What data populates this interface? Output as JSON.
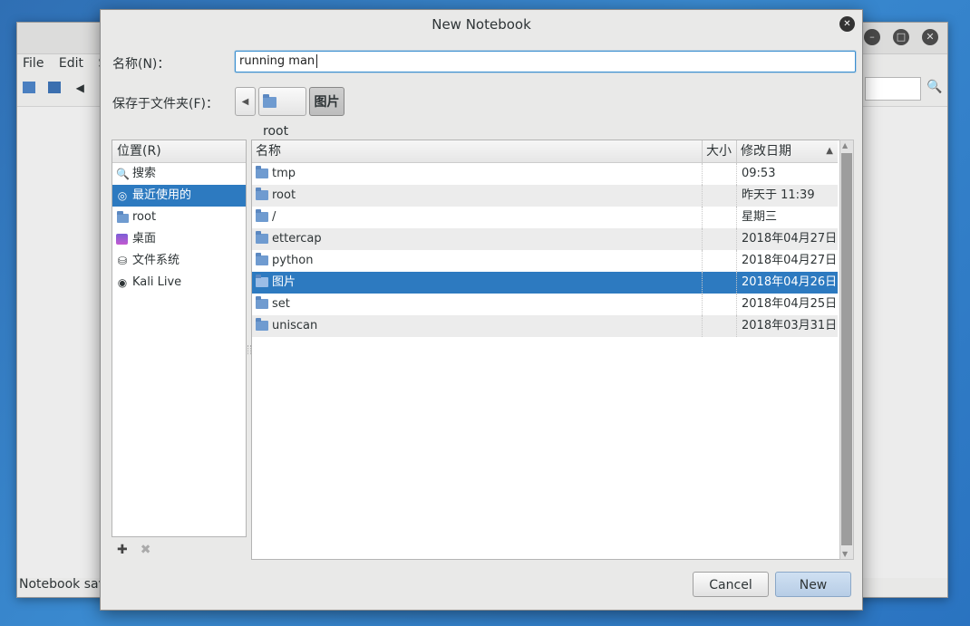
{
  "background_window": {
    "menu": [
      "File",
      "Edit",
      "Se"
    ],
    "status": "Notebook save"
  },
  "dialog": {
    "title": "New Notebook",
    "name_label": "名称(N)：",
    "name_value": "running man",
    "folder_label": "保存于文件夹(F)：",
    "path": [
      "root",
      "图片"
    ]
  },
  "places": {
    "header": "位置(R)",
    "items": [
      {
        "label": "搜索",
        "icon": "search-icon"
      },
      {
        "label": "最近使用的",
        "icon": "recent-icon",
        "selected": true
      },
      {
        "label": "root",
        "icon": "home-folder-icon"
      },
      {
        "label": "桌面",
        "icon": "desktop-icon"
      },
      {
        "label": "文件系统",
        "icon": "filesystem-icon"
      },
      {
        "label": "Kali Live",
        "icon": "disc-icon"
      }
    ]
  },
  "files": {
    "columns": {
      "name": "名称",
      "size": "大小",
      "modified": "修改日期"
    },
    "rows": [
      {
        "name": "tmp",
        "size": "",
        "modified": "09:53"
      },
      {
        "name": "root",
        "size": "",
        "modified": "昨天于 11:39"
      },
      {
        "name": "/",
        "size": "",
        "modified": "星期三"
      },
      {
        "name": "ettercap",
        "size": "",
        "modified": "2018年04月27日"
      },
      {
        "name": "python",
        "size": "",
        "modified": "2018年04月27日"
      },
      {
        "name": "图片",
        "size": "",
        "modified": "2018年04月26日",
        "selected": true
      },
      {
        "name": "set",
        "size": "",
        "modified": "2018年04月25日"
      },
      {
        "name": "uniscan",
        "size": "",
        "modified": "2018年03月31日"
      }
    ]
  },
  "buttons": {
    "cancel": "Cancel",
    "new": "New"
  },
  "colors": {
    "selection": "#2d7ac0",
    "folder": "#6f9bd0",
    "focus": "#3a8fd0"
  }
}
